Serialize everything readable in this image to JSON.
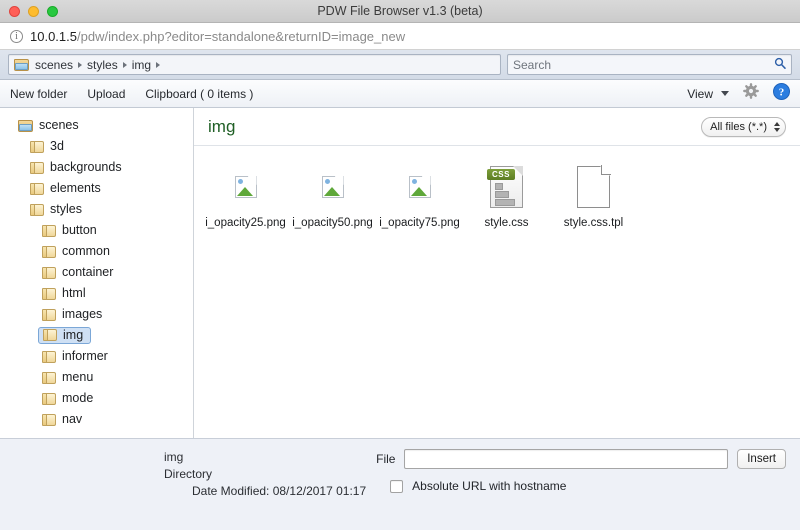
{
  "window": {
    "title": "PDW File Browser v1.3 (beta)",
    "traffic_lights": [
      "close-red",
      "minimize-yellow",
      "zoom-green"
    ]
  },
  "address_bar": {
    "info_icon": "info-circle-icon",
    "host": "10.0.1.5",
    "path": "/pdw/index.php?editor=standalone&returnID=image_new"
  },
  "path_bar": {
    "folder_icon": "open-folder-icon",
    "crumbs": [
      "scenes",
      "styles",
      "img"
    ],
    "search": {
      "placeholder": "Search",
      "value": "",
      "icon": "search-icon"
    }
  },
  "toolbar": {
    "new_folder": "New folder",
    "upload": "Upload",
    "clipboard": "Clipboard ( 0 items )",
    "view": "View",
    "view_caret": "chevron-down-icon",
    "settings_icon": "gear-icon",
    "help_icon": "help-circle-icon"
  },
  "sidebar": {
    "items": [
      {
        "label": "scenes",
        "depth": 0,
        "icon": "open-folder-icon",
        "selected": false
      },
      {
        "label": "3d",
        "depth": 1,
        "icon": "closed-folder-icon",
        "selected": false
      },
      {
        "label": "backgrounds",
        "depth": 1,
        "icon": "closed-folder-icon",
        "selected": false
      },
      {
        "label": "elements",
        "depth": 1,
        "icon": "closed-folder-icon",
        "selected": false
      },
      {
        "label": "styles",
        "depth": 1,
        "icon": "closed-folder-icon",
        "selected": false
      },
      {
        "label": "button",
        "depth": 2,
        "icon": "closed-folder-icon",
        "selected": false
      },
      {
        "label": "common",
        "depth": 2,
        "icon": "closed-folder-icon",
        "selected": false
      },
      {
        "label": "container",
        "depth": 2,
        "icon": "closed-folder-icon",
        "selected": false
      },
      {
        "label": "html",
        "depth": 2,
        "icon": "closed-folder-icon",
        "selected": false
      },
      {
        "label": "images",
        "depth": 2,
        "icon": "closed-folder-icon",
        "selected": false
      },
      {
        "label": "img",
        "depth": 2,
        "icon": "closed-folder-icon",
        "selected": true
      },
      {
        "label": "informer",
        "depth": 2,
        "icon": "closed-folder-icon",
        "selected": false
      },
      {
        "label": "menu",
        "depth": 2,
        "icon": "closed-folder-icon",
        "selected": false
      },
      {
        "label": "mode",
        "depth": 2,
        "icon": "closed-folder-icon",
        "selected": false
      },
      {
        "label": "nav",
        "depth": 2,
        "icon": "closed-folder-icon",
        "selected": false
      }
    ]
  },
  "main": {
    "title": "img",
    "title_color": "#1f5f25",
    "filter": {
      "value": "All files (*.*)",
      "icon": "stepper-icon"
    },
    "files": [
      {
        "name": "i_opacity25.png",
        "icon": "broken-image-icon"
      },
      {
        "name": "i_opacity50.png",
        "icon": "broken-image-icon"
      },
      {
        "name": "i_opacity75.png",
        "icon": "broken-image-icon"
      },
      {
        "name": "style.css",
        "icon": "css-file-icon",
        "badge": "CSS"
      },
      {
        "name": "style.css.tpl",
        "icon": "plain-file-icon"
      }
    ]
  },
  "footer": {
    "info": {
      "name": "img",
      "type": "Directory",
      "date_modified": "Date Modified: 08/12/2017 01:17"
    },
    "form": {
      "file_label": "File",
      "file_value": "",
      "insert_label": "Insert",
      "checkbox_label": "Absolute URL with hostname",
      "checkbox_checked": false
    }
  }
}
